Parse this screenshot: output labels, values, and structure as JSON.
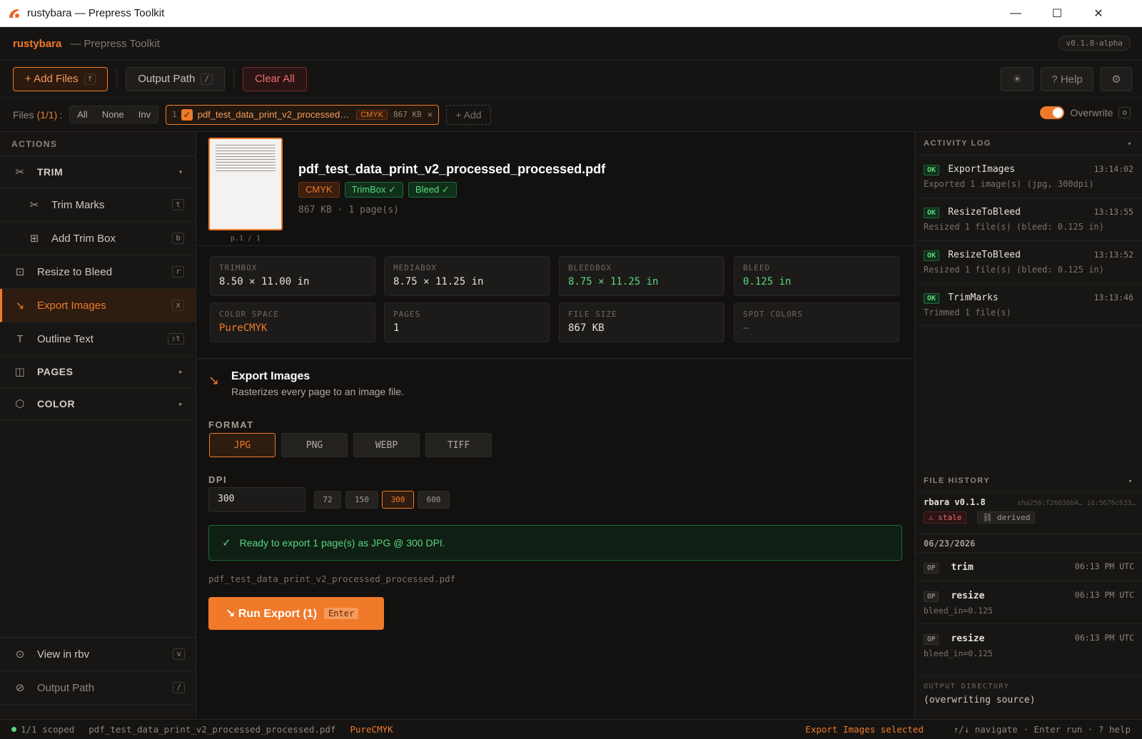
{
  "window": {
    "title": "rustybara — Prepress Toolkit",
    "minimize": "—",
    "maximize": "☐",
    "close": "✕"
  },
  "header": {
    "brand": "rustybara",
    "subtitle": "— Prepress Toolkit",
    "version": "v0.1.8-alpha"
  },
  "toolbar": {
    "add_files": "+ Add Files",
    "add_files_key": "f",
    "output_path": "Output Path",
    "output_path_key": "/",
    "clear_all": "Clear All",
    "theme_icon": "sun-icon",
    "theme": "☀",
    "help": "? Help",
    "settings_icon": "gear-icon",
    "settings": "⚙"
  },
  "files": {
    "label": "Files",
    "count": "(1/1)",
    "colon": ":",
    "select_all": "All",
    "select_none": "None",
    "select_invert": "Inv",
    "chip": {
      "index": "1",
      "check": "✓",
      "name": "pdf_test_data_print_v2_processed…",
      "colorspace": "CMYK",
      "size": "867 KB",
      "remove": "×"
    },
    "add": "+ Add",
    "overwrite_label": "Overwrite",
    "overwrite_key": "o",
    "overwrite_on": true
  },
  "sidebar": {
    "heading": "ACTIONS",
    "trim_group": "TRIM",
    "trim_caret": "▾",
    "items": [
      {
        "label": "Trim Marks",
        "key": "t",
        "icon": "scissors-icon"
      },
      {
        "label": "Add Trim Box",
        "key": "b",
        "icon": "grid-icon"
      },
      {
        "label": "Resize to Bleed",
        "key": "r",
        "icon": "resize-icon"
      },
      {
        "label": "Export Images",
        "key": "x",
        "icon": "export-arrow-icon"
      },
      {
        "label": "Outline Text",
        "key": "⇧t",
        "icon": "text-icon"
      }
    ],
    "pages_group": "PAGES",
    "color_group": "COLOR",
    "collapsed_caret": "▸",
    "view_rbv": "View in rbv",
    "view_rbv_key": "v",
    "output_path": "Output Path",
    "output_path_key": "/"
  },
  "file_detail": {
    "page_caption": "p.1 / 1",
    "name": "pdf_test_data_print_v2_processed_processed.pdf",
    "badges": {
      "cmyk": "CMYK",
      "trimbox": "TrimBox ✓",
      "bleed": "Bleed ✓"
    },
    "meta": "867 KB · 1 page(s)"
  },
  "stats": [
    {
      "label": "TRIMBOX",
      "value": "8.50 × 11.00 in"
    },
    {
      "label": "MEDIABOX",
      "value": "8.75 × 11.25 in"
    },
    {
      "label": "BLEEDBOX",
      "value": "8.75 × 11.25 in"
    },
    {
      "label": "BLEED",
      "value": "0.125 in"
    },
    {
      "label": "COLOR SPACE",
      "value": "PureCMYK"
    },
    {
      "label": "PAGES",
      "value": "1"
    },
    {
      "label": "FILE SIZE",
      "value": "867 KB"
    },
    {
      "label": "SPOT COLORS",
      "value": "—"
    }
  ],
  "action": {
    "title": "Export Images",
    "description": "Rasterizes every page to an image file.",
    "format_label": "FORMAT",
    "formats": [
      "JPG",
      "PNG",
      "WEBP",
      "TIFF"
    ],
    "selected_format": "JPG",
    "dpi_label": "DPI",
    "dpi_value": "300",
    "dpi_presets": [
      "72",
      "150",
      "300",
      "600"
    ],
    "ready_check": "✓",
    "ready": "Ready to export 1 page(s) as JPG @ 300 DPI.",
    "path": "pdf_test_data_print_v2_processed_processed.pdf",
    "run_label": "↘ Run Export (1)",
    "run_key": "Enter"
  },
  "activity_log": {
    "heading": "ACTIVITY LOG",
    "caret": "▾",
    "entries": [
      {
        "status": "OK",
        "op": "ExportImages",
        "time": "13:14:02",
        "msg": "Exported 1 image(s) (jpg, 300dpi)"
      },
      {
        "status": "OK",
        "op": "ResizeToBleed",
        "time": "13:13:55",
        "msg": "Resized 1 file(s) (bleed: 0.125 in)"
      },
      {
        "status": "OK",
        "op": "ResizeToBleed",
        "time": "13:13:52",
        "msg": "Resized 1 file(s) (bleed: 0.125 in)"
      },
      {
        "status": "OK",
        "op": "TrimMarks",
        "time": "13:13:46",
        "msg": "Trimmed 1 file(s)"
      }
    ]
  },
  "file_history": {
    "heading": "FILE HISTORY",
    "caret": "▾",
    "version": "rbara v0.1.8",
    "sha": "sha256:f26036b4… id:5676c633…",
    "stale": "⚠ stale",
    "derived": "⛓ derived",
    "date": "06/23/2026",
    "ops": [
      {
        "tag": "OP",
        "name": "trim",
        "time": "06:13 PM UTC",
        "arg": ""
      },
      {
        "tag": "OP",
        "name": "resize",
        "time": "06:13 PM UTC",
        "arg": "bleed_in=0.125"
      },
      {
        "tag": "OP",
        "name": "resize",
        "time": "06:13 PM UTC",
        "arg": "bleed_in=0.125"
      }
    ],
    "output_dir_label": "OUTPUT DIRECTORY",
    "output_dir": "(overwriting source)"
  },
  "status": {
    "scope": "1/1 scoped",
    "file": "pdf_test_data_print_v2_processed_processed.pdf",
    "colorspace": "PureCMYK",
    "selected": "Export Images selected",
    "hints": "↑/↓ navigate · Enter run · ? help"
  },
  "colors": {
    "accent": "#f07a2a",
    "ok": "#5cd67f",
    "danger": "#f06b6b",
    "background": "#121110"
  }
}
